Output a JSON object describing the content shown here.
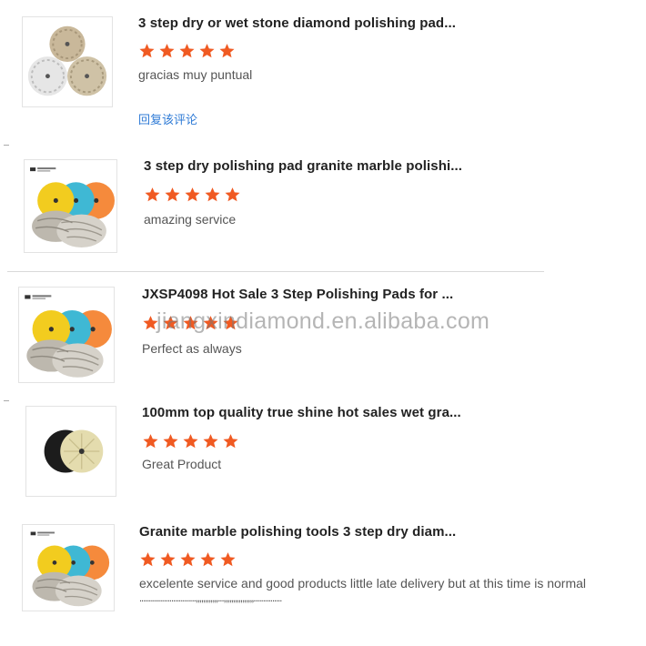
{
  "reviews": [
    {
      "title": "3 step dry or wet stone diamond polishing pad...",
      "rating": 5,
      "comment": "gracias muy puntual",
      "reply_label": "回复该评论",
      "image": "white-polishing-pads-icon"
    },
    {
      "title": "3 step dry polishing pad granite marble polishi...",
      "rating": 5,
      "comment": "amazing service",
      "image": "colored-polishing-pads-icon"
    },
    {
      "title": "JXSP4098 Hot Sale 3 Step Polishing Pads for ...",
      "rating": 5,
      "comment": "Perfect as always",
      "image": "colored-polishing-pads-icon"
    },
    {
      "title": "100mm top quality true shine hot sales wet gra...",
      "rating": 5,
      "comment": "Great Product",
      "image": "black-white-polishing-pads-icon"
    },
    {
      "title": "Granite marble polishing tools 3 step dry diam...",
      "rating": 5,
      "comment": "excelente service and good products little late delivery but at this time is normal",
      "extra": "..............................,,,,,,,,,,,,...,,,,,,,,,,,,,,,,...............",
      "image": "colored-polishing-pads-icon"
    }
  ],
  "watermark": "jiangxindiamond.en.alibaba.com",
  "colors": {
    "star": "#f05a22",
    "link": "#2f7bd6"
  }
}
